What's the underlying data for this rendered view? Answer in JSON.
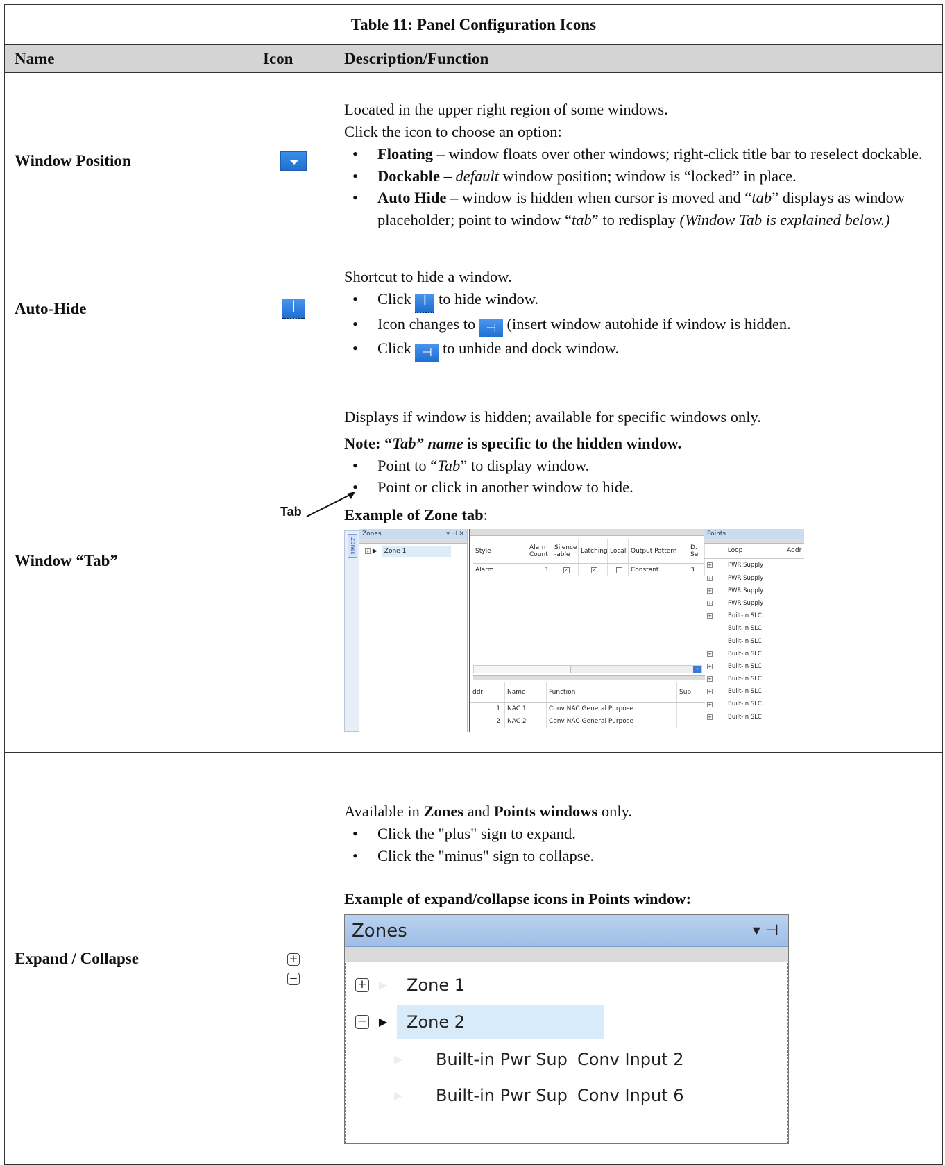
{
  "table": {
    "title": "Table 11: Panel Configuration Icons",
    "headers": {
      "name": "Name",
      "icon": "Icon",
      "description": "Description/Function"
    }
  },
  "rows": {
    "window_position": {
      "name": "Window Position",
      "icon_name": "dropdown-arrow-icon",
      "p1": "Located in the upper right region of some windows.",
      "p2": "Click the icon to choose an option:",
      "b1_term": "Floating",
      "b1_text": " – window floats over other windows; right-click title bar to reselect dockable.",
      "b2_term": "Dockable – ",
      "b2_em": "default",
      "b2_text": " window position; window is “locked” in place.",
      "b3_term": "Auto Hide",
      "b3_text_a": " – window is hidden when cursor is moved and “",
      "b3_em1": "tab",
      "b3_text_b": "” displays as window placeholder; point to window “",
      "b3_em2": "tab",
      "b3_text_c": "” to redisplay ",
      "b3_note": "(Window Tab is explained below.)"
    },
    "auto_hide": {
      "name": "Auto-Hide",
      "icon_name": "pin-icon",
      "p1": "Shortcut to hide a window.",
      "b1_a": "Click ",
      "b1_b": " to hide window.",
      "b2_a": "Icon changes to ",
      "b2_b": " (insert window autohide if window is hidden.",
      "b3_a": "Click ",
      "b3_b": " to unhide and dock window."
    },
    "window_tab": {
      "name": "Window “Tab”",
      "p1": "Displays if window is hidden; available for specific windows only.",
      "note_a": "Note: “",
      "note_em": "Tab” name",
      "note_b": " is specific to the hidden window.",
      "b1_a": "Point to “",
      "b1_em": "Tab",
      "b1_b": "” to display window.",
      "b2": "Point or click in another window to hide.",
      "example_label": "Example of Zone tab",
      "example_colon": ":",
      "callout": "Tab",
      "shot": {
        "zones_tab": "Zones",
        "zones_title": "Zones",
        "zones_controls": "▾ ⊣ ✕",
        "zone_row": "Zone 1",
        "grid_headers": [
          "Style",
          "Alarm Count",
          "Silence -able",
          "Latching",
          "Local",
          "Output Pattern",
          "D. Se"
        ],
        "grid_row": {
          "style": "Alarm",
          "count": "1",
          "output": "Constant",
          "extra": "3"
        },
        "grid2_headers": [
          "ddr",
          "Name",
          "Function",
          "Sup"
        ],
        "grid2_rows": [
          {
            "addr": "1",
            "name": "NAC 1",
            "function": "Conv NAC General Purpose"
          },
          {
            "addr": "2",
            "name": "NAC 2",
            "function": "Conv NAC General Purpose"
          }
        ],
        "points_title": "Points",
        "points_headers": [
          "Loop",
          "Addr"
        ],
        "points_rows": [
          {
            "loop": "PWR Supply",
            "pm": true
          },
          {
            "loop": "PWR Supply",
            "pm": true
          },
          {
            "loop": "PWR Supply",
            "pm": true
          },
          {
            "loop": "PWR Supply",
            "pm": true
          },
          {
            "loop": "Built-in SLC",
            "pm": true
          },
          {
            "loop": "Built-in SLC",
            "pm": false
          },
          {
            "loop": "Built-in SLC",
            "pm": false
          },
          {
            "loop": "Built-in SLC",
            "pm": true
          },
          {
            "loop": "Built-in SLC",
            "pm": true
          },
          {
            "loop": "Built-in SLC",
            "pm": true
          },
          {
            "loop": "Built-in SLC",
            "pm": true
          },
          {
            "loop": "Built-in SLC",
            "pm": true
          },
          {
            "loop": "Built-in SLC",
            "pm": true
          }
        ]
      }
    },
    "expand_collapse": {
      "name": "Expand / Collapse",
      "icon_plus": "+",
      "icon_minus": "−",
      "p1_a": "Available in ",
      "p1_b": "Zones",
      "p1_c": " and ",
      "p1_d": "Points windows",
      "p1_e": " only.",
      "b1": "Click the \"plus\" sign to expand.",
      "b2": "Click the \"minus\" sign to collapse.",
      "example_label": "Example of expand/collapse icons in Points window:",
      "shot": {
        "title": "Zones",
        "controls": "▾ ⊣",
        "zone1": "Zone 1",
        "zone2": "Zone 2",
        "child1_name": "Built-in Pwr Sup",
        "child1_func": "Conv Input 2",
        "child2_name": "Built-in Pwr Sup",
        "child2_func": "Conv Input 6"
      }
    }
  }
}
